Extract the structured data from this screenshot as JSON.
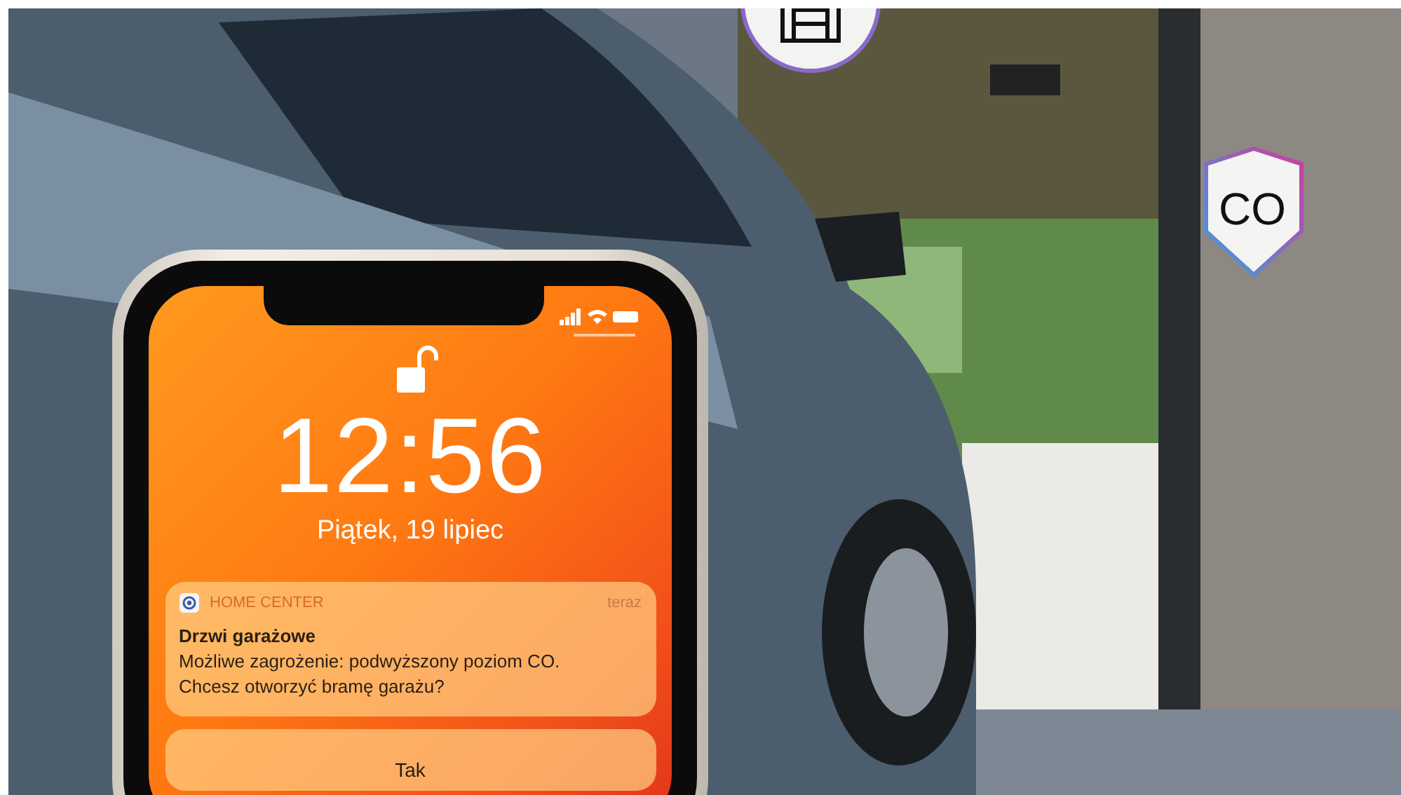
{
  "co_badge": {
    "label": "CO"
  },
  "phone": {
    "lock_screen": {
      "locked": false,
      "time": "12:56",
      "date": "Piątek, 19 lipiec"
    },
    "notification": {
      "app": "HOME CENTER",
      "time": "teraz",
      "title": "Drzwi garażowe",
      "lines": [
        "Możliwe zagrożenie: podwyższony poziom CO.",
        "Chcesz otworzyć bramę garażu?"
      ]
    },
    "action_button": "Tak"
  }
}
